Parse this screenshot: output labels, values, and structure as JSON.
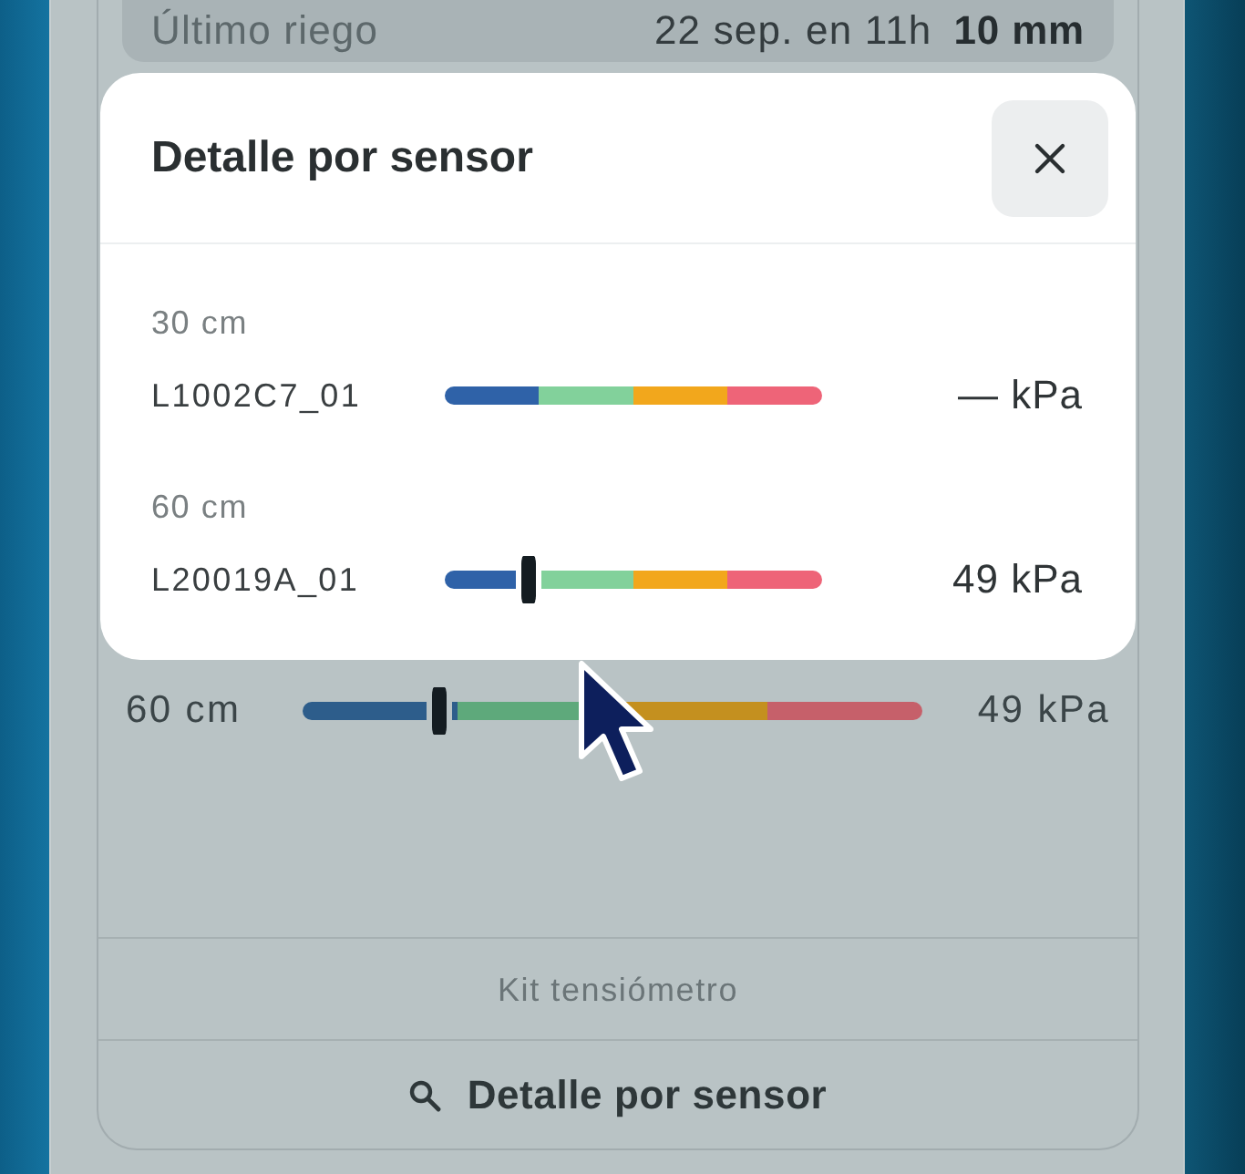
{
  "background_card": {
    "last_irrigation": {
      "label": "Último riego",
      "when": "22 sep. en 11h",
      "amount": "10 mm"
    },
    "sensor_row": {
      "depth": "60 cm",
      "level": 0.22,
      "reading": "49 kPa"
    },
    "kit_label": "Kit tensiómetro",
    "detail_button": {
      "label": "Detalle por sensor"
    }
  },
  "dialog": {
    "title": "Detalle por sensor",
    "sensors": [
      {
        "depth": "30 cm",
        "id": "L1002C7_01",
        "reading": "— kPa"
      },
      {
        "depth": "60 cm",
        "id": "L20019A_01",
        "level": 0.22,
        "reading": "49 kPa"
      }
    ]
  }
}
